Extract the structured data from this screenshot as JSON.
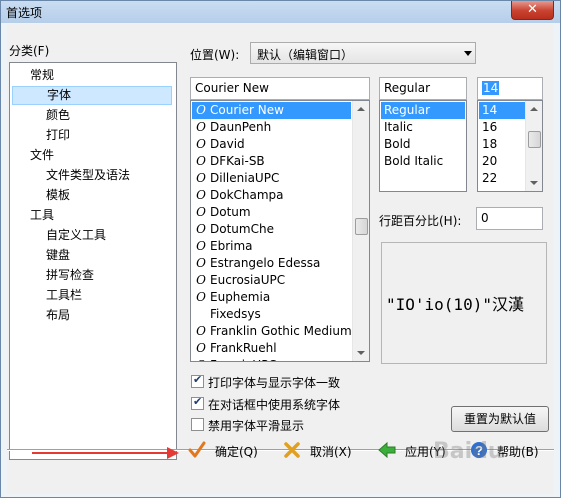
{
  "window": {
    "title": "首选项",
    "close_symbol": "✕"
  },
  "category": {
    "label": "分类(F)",
    "items": [
      {
        "label": "常规",
        "level": 0
      },
      {
        "label": "字体",
        "level": 1,
        "selected": true
      },
      {
        "label": "颜色",
        "level": 1
      },
      {
        "label": "打印",
        "level": 1
      },
      {
        "label": "文件",
        "level": 0
      },
      {
        "label": "文件类型及语法",
        "level": 1
      },
      {
        "label": "模板",
        "level": 1
      },
      {
        "label": "工具",
        "level": 0
      },
      {
        "label": "自定义工具",
        "level": 1
      },
      {
        "label": "键盘",
        "level": 1
      },
      {
        "label": "拼写检查",
        "level": 1
      },
      {
        "label": "工具栏",
        "level": 1
      },
      {
        "label": "布局",
        "level": 1
      }
    ]
  },
  "position": {
    "label": "位置(W):",
    "value": "默认（编辑窗口）"
  },
  "font": {
    "value": "Courier New",
    "glyph": "O",
    "list": [
      {
        "name": "Courier New",
        "selected": true
      },
      {
        "name": "DaunPenh"
      },
      {
        "name": "David"
      },
      {
        "name": "DFKai-SB"
      },
      {
        "name": "DilleniaUPC"
      },
      {
        "name": "DokChampa"
      },
      {
        "name": "Dotum"
      },
      {
        "name": "DotumChe"
      },
      {
        "name": "Ebrima"
      },
      {
        "name": "Estrangelo Edessa"
      },
      {
        "name": "EucrosiaUPC"
      },
      {
        "name": "Euphemia"
      },
      {
        "name": "Fixedsys",
        "no_glyph": true
      },
      {
        "name": "Franklin Gothic Medium"
      },
      {
        "name": "FrankRuehl"
      },
      {
        "name": "FreesiaUPC"
      }
    ]
  },
  "style": {
    "value": "Regular",
    "list": [
      {
        "name": "Regular",
        "selected": true
      },
      {
        "name": "Italic"
      },
      {
        "name": "Bold"
      },
      {
        "name": "Bold Italic"
      }
    ]
  },
  "size": {
    "value": "14",
    "list": [
      {
        "name": "14",
        "selected": true
      },
      {
        "name": "16"
      },
      {
        "name": "18"
      },
      {
        "name": "20"
      },
      {
        "name": "22"
      }
    ]
  },
  "line_spacing": {
    "label": "行距百分比(H):",
    "value": "0"
  },
  "preview": {
    "text": "\"IO'io(10)\"汉漢"
  },
  "options": [
    {
      "label": "打印字体与显示字体一致",
      "checked": true
    },
    {
      "label": "在对话框中使用系统字体",
      "checked": true
    },
    {
      "label": "禁用字体平滑显示",
      "checked": false
    }
  ],
  "reset_button": "重置为默认值",
  "buttons": {
    "ok": "确定(Q)",
    "cancel": "取消(X)",
    "apply": "应用(Y)",
    "help": "帮助(B)"
  },
  "watermark": "Baidu",
  "colors": {
    "selection": "#3399ff",
    "arrow": "#e43a36",
    "close": "#c9412f"
  }
}
